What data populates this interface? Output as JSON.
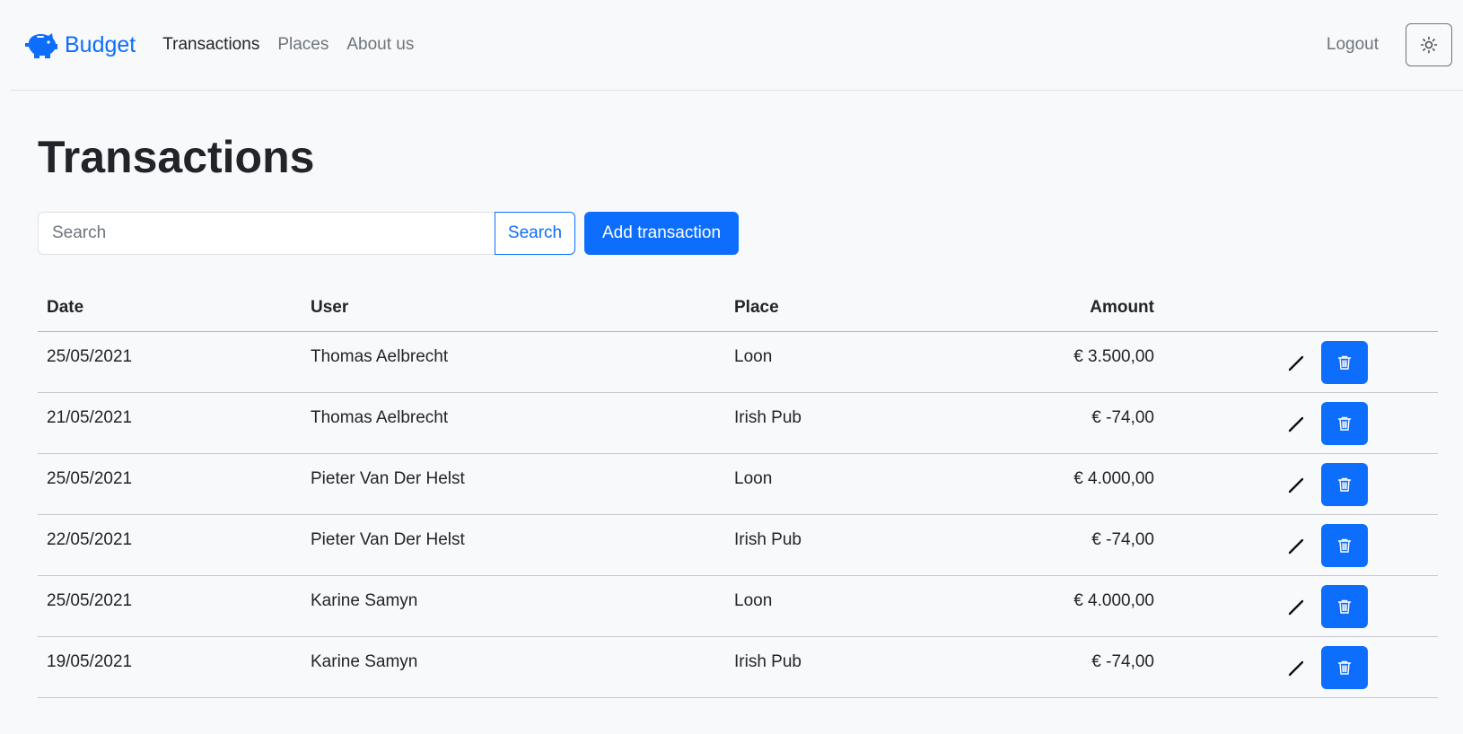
{
  "nav": {
    "brand": "Budget",
    "links": [
      "Transactions",
      "Places",
      "About us"
    ],
    "logout": "Logout"
  },
  "page": {
    "title": "Transactions"
  },
  "search": {
    "placeholder": "Search",
    "button": "Search",
    "add_button": "Add transaction"
  },
  "table": {
    "headers": {
      "date": "Date",
      "user": "User",
      "place": "Place",
      "amount": "Amount"
    },
    "rows": [
      {
        "date": "25/05/2021",
        "user": "Thomas Aelbrecht",
        "place": "Loon",
        "amount": "€ 3.500,00"
      },
      {
        "date": "21/05/2021",
        "user": "Thomas Aelbrecht",
        "place": "Irish Pub",
        "amount": "€ -74,00"
      },
      {
        "date": "25/05/2021",
        "user": "Pieter Van Der Helst",
        "place": "Loon",
        "amount": "€ 4.000,00"
      },
      {
        "date": "22/05/2021",
        "user": "Pieter Van Der Helst",
        "place": "Irish Pub",
        "amount": "€ -74,00"
      },
      {
        "date": "25/05/2021",
        "user": "Karine Samyn",
        "place": "Loon",
        "amount": "€ 4.000,00"
      },
      {
        "date": "19/05/2021",
        "user": "Karine Samyn",
        "place": "Irish Pub",
        "amount": "€ -74,00"
      }
    ]
  },
  "colors": {
    "primary": "#0d6efd",
    "background": "#f8f9fa",
    "text": "#212529",
    "muted": "#6c757d"
  },
  "icons": {
    "brand": "piggy-bank-icon",
    "theme": "sun-icon",
    "edit": "pencil-icon",
    "delete": "trash-icon"
  }
}
